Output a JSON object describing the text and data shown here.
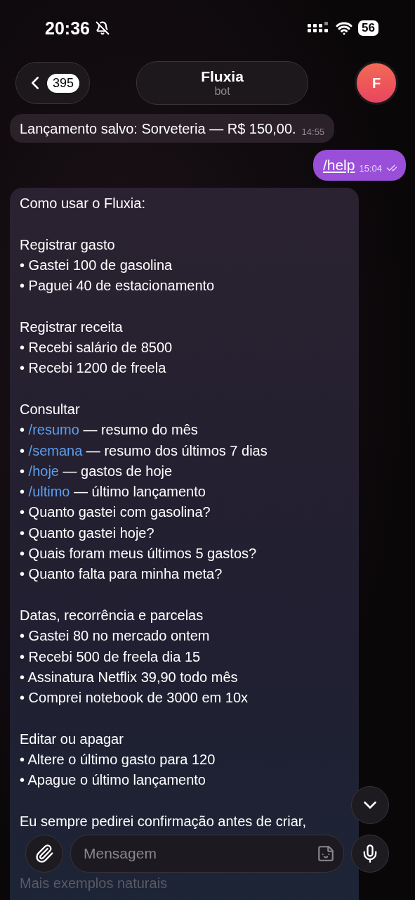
{
  "status_bar": {
    "time": "20:36",
    "battery": "56"
  },
  "header": {
    "back_count": "395",
    "title": "Fluxia",
    "subtitle": "bot",
    "avatar_letter": "F"
  },
  "messages": [
    {
      "kind": "incoming",
      "text": "Lançamento salvo: Sorveteria — R$ 150,00.",
      "time": "14:55"
    },
    {
      "kind": "outgoing",
      "text": "/help",
      "time": "15:04",
      "read": true
    }
  ],
  "help_message": {
    "intro": "Como usar o Fluxia:",
    "sections": [
      {
        "title": "Registrar gasto",
        "items": [
          {
            "bullet": "•",
            "text": "Gastei 100 de gasolina"
          },
          {
            "bullet": "•",
            "text": "Paguei 40 de estacionamento"
          }
        ]
      },
      {
        "title": "Registrar receita",
        "items": [
          {
            "bullet": "•",
            "text": "Recebi salário de 8500"
          },
          {
            "bullet": "•",
            "text": "Recebi 1200 de freela"
          }
        ]
      },
      {
        "title": "Consultar",
        "items": [
          {
            "bullet": "•",
            "command": "/resumo",
            "text": "— resumo do mês"
          },
          {
            "bullet": "•",
            "command": "/semana",
            "text": "— resumo dos últimos 7 dias"
          },
          {
            "bullet": "•",
            "command": "/hoje",
            "text": "— gastos de hoje"
          },
          {
            "bullet": "•",
            "command": "/ultimo",
            "text": "— último lançamento"
          },
          {
            "bullet": "•",
            "text": "Quanto gastei com gasolina?"
          },
          {
            "bullet": "•",
            "text": "Quanto gastei hoje?"
          },
          {
            "bullet": "•",
            "text": "Quais foram meus últimos 5 gastos?"
          },
          {
            "bullet": "•",
            "text": "Quanto falta para minha meta?"
          }
        ]
      },
      {
        "title": "Datas, recorrência e parcelas",
        "items": [
          {
            "bullet": "•",
            "text": "Gastei 80 no mercado ontem"
          },
          {
            "bullet": "•",
            "text": "Recebi 500 de freela dia 15"
          },
          {
            "bullet": "•",
            "text": "Assinatura Netflix 39,90 todo mês"
          },
          {
            "bullet": "•",
            "text": "Comprei notebook de 3000 em 10x"
          }
        ]
      },
      {
        "title": "Editar ou apagar",
        "items": [
          {
            "bullet": "•",
            "text": "Altere o último gasto para 120"
          },
          {
            "bullet": "•",
            "text": "Apague o último lançamento"
          }
        ]
      }
    ],
    "footer": "Eu sempre pedirei confirmação antes de criar,",
    "faded": "Mais exemplos naturais"
  },
  "composer": {
    "placeholder": "Mensagem"
  }
}
